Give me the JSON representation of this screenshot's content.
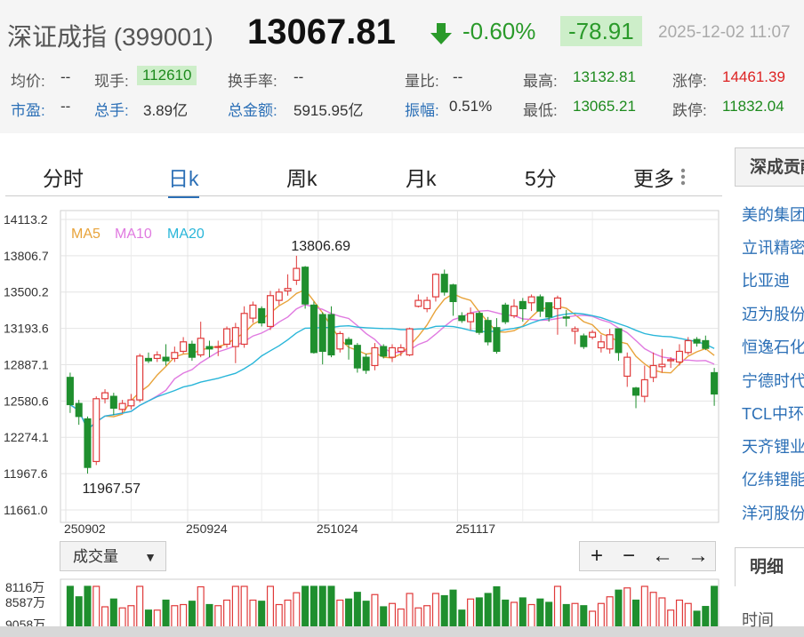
{
  "header": {
    "name": "深证成指 (399001)",
    "price": "13067.81",
    "pct": "-0.60%",
    "change": "-78.91",
    "time": "2025-12-02 11:07"
  },
  "quote": {
    "row1": [
      {
        "label": "均价:",
        "value": "--"
      },
      {
        "label": "现手:",
        "value": "112610"
      },
      {
        "label": "换手率:",
        "value": "--"
      },
      {
        "label": "量比:",
        "value": "--"
      },
      {
        "label": "最高:",
        "value": "13132.81"
      },
      {
        "label": "涨停:",
        "value": "14461.39"
      }
    ],
    "row2": [
      {
        "label": "市盈:",
        "value": "--"
      },
      {
        "label": "总手:",
        "value": "3.89亿"
      },
      {
        "label": "总金额:",
        "value": "5915.95亿"
      },
      {
        "label": "振幅:",
        "value": "0.51%"
      },
      {
        "label": "最低:",
        "value": "13065.21"
      },
      {
        "label": "跌停:",
        "value": "11832.04"
      }
    ]
  },
  "tabs": [
    "分时",
    "日k",
    "周k",
    "月k",
    "5分",
    "更多"
  ],
  "active_tab": "日k",
  "volume_selector": "成交量",
  "nav_buttons": [
    "+",
    "−",
    "←",
    "→"
  ],
  "sidebar": {
    "title": "深成贡献",
    "stocks": [
      "美的集团",
      "立讯精密",
      "比亚迪",
      "迈为股份",
      "恒逸石化",
      "宁德时代",
      "TCL中环",
      "天齐锂业",
      "亿纬锂能",
      "洋河股份"
    ],
    "detail_title": "明细",
    "detail_col": "时间"
  },
  "colors": {
    "up": "#e03a3a",
    "down": "#1f8f2e",
    "ma5": "#e8a33a",
    "ma10": "#e07ae0",
    "ma20": "#29b6d9",
    "accent": "#2b6fb6"
  },
  "chart_data": {
    "type": "candlestick",
    "ylim": [
      11661.0,
      14113.2
    ],
    "y_ticks": [
      "14113.2",
      "13806.7",
      "13500.2",
      "13193.6",
      "12887.1",
      "12580.6",
      "12274.1",
      "11967.6",
      "11661.0"
    ],
    "x_ticks": [
      "250902",
      "250924",
      "251024",
      "251117"
    ],
    "legend": [
      "MA5",
      "MA10",
      "MA20"
    ],
    "annotations": {
      "high": "13806.69",
      "low": "11967.57"
    },
    "candles": [
      [
        12780,
        12550,
        12820,
        12480
      ],
      [
        12560,
        12450,
        12590,
        12380
      ],
      [
        12430,
        12020,
        12450,
        11967.57
      ],
      [
        12070,
        12600,
        12620,
        12040
      ],
      [
        12600,
        12650,
        12680,
        12560
      ],
      [
        12620,
        12520,
        12650,
        12460
      ],
      [
        12510,
        12560,
        12590,
        12480
      ],
      [
        12540,
        12590,
        12640,
        12510
      ],
      [
        12590,
        12960,
        12980,
        12570
      ],
      [
        12940,
        12920,
        12990,
        12900
      ],
      [
        12940,
        12970,
        13000,
        12910
      ],
      [
        12950,
        12920,
        13060,
        12880
      ],
      [
        12940,
        12990,
        13040,
        12910
      ],
      [
        13000,
        13080,
        13120,
        12980
      ],
      [
        13060,
        12950,
        13090,
        12920
      ],
      [
        12970,
        13110,
        13250,
        12950
      ],
      [
        13040,
        13020,
        13090,
        12950
      ],
      [
        13040,
        13040,
        13090,
        12960
      ],
      [
        13060,
        13190,
        13210,
        13030
      ],
      [
        13040,
        13200,
        13240,
        12900
      ],
      [
        13060,
        13320,
        13380,
        13030
      ],
      [
        13280,
        13390,
        13420,
        13240
      ],
      [
        13360,
        13240,
        13380,
        13210
      ],
      [
        13210,
        13470,
        13510,
        13180
      ],
      [
        13430,
        13500,
        13530,
        13390
      ],
      [
        13510,
        13530,
        13650,
        13470
      ],
      [
        13600,
        13700,
        13806.69,
        13560
      ],
      [
        13710,
        13400,
        13720,
        13360
      ],
      [
        13390,
        12990,
        13420,
        12980
      ],
      [
        13310,
        13000,
        13330,
        12890
      ],
      [
        13310,
        12970,
        13380,
        12950
      ],
      [
        13020,
        13150,
        13170,
        12990
      ],
      [
        13100,
        13060,
        13120,
        12930
      ],
      [
        13050,
        12860,
        13070,
        12820
      ],
      [
        12950,
        12840,
        12980,
        12810
      ],
      [
        12880,
        13030,
        13070,
        12840
      ],
      [
        13040,
        12960,
        13060,
        12940
      ],
      [
        12950,
        13030,
        13060,
        12910
      ],
      [
        13000,
        13030,
        13060,
        12960
      ],
      [
        12970,
        13190,
        13200,
        12960
      ],
      [
        13380,
        13430,
        13480,
        13370
      ],
      [
        13360,
        13430,
        13460,
        13330
      ],
      [
        13460,
        13650,
        13660,
        13420
      ],
      [
        13650,
        13500,
        13690,
        13470
      ],
      [
        13560,
        13420,
        13570,
        13300
      ],
      [
        13300,
        13260,
        13330,
        13240
      ],
      [
        13250,
        13320,
        13370,
        13180
      ],
      [
        13320,
        13160,
        13340,
        13140
      ],
      [
        13260,
        13080,
        13290,
        13050
      ],
      [
        13200,
        13000,
        13280,
        12980
      ],
      [
        13390,
        13250,
        13410,
        13230
      ],
      [
        13300,
        13380,
        13440,
        13280
      ],
      [
        13420,
        13360,
        13450,
        13250
      ],
      [
        13410,
        13460,
        13480,
        13340
      ],
      [
        13460,
        13340,
        13480,
        13290
      ],
      [
        13410,
        13290,
        13410,
        13250
      ],
      [
        13360,
        13450,
        13470,
        13140
      ],
      [
        13290,
        13280,
        13350,
        13210
      ],
      [
        13170,
        13190,
        13210,
        13060
      ],
      [
        13130,
        13040,
        13150,
        13020
      ],
      [
        13120,
        13160,
        13180,
        13100
      ],
      [
        13030,
        13080,
        13140,
        12990
      ],
      [
        13020,
        13140,
        13190,
        12980
      ],
      [
        13190,
        12990,
        13190,
        12920
      ],
      [
        12790,
        12950,
        12990,
        12700
      ],
      [
        12690,
        12630,
        12700,
        12520
      ],
      [
        12620,
        12760,
        12880,
        12570
      ],
      [
        12780,
        12880,
        12990,
        12740
      ],
      [
        12870,
        12890,
        13020,
        12820
      ],
      [
        12920,
        12930,
        12950,
        12860
      ],
      [
        12910,
        13000,
        13060,
        12880
      ],
      [
        12990,
        13090,
        13120,
        12970
      ],
      [
        13100,
        13070,
        13120,
        13040
      ],
      [
        13090,
        13025,
        13132.81,
        13010
      ],
      [
        12820,
        12640,
        12860,
        12540
      ]
    ],
    "volume_labels": [
      "8116万",
      "8587万",
      "9058万"
    ]
  }
}
